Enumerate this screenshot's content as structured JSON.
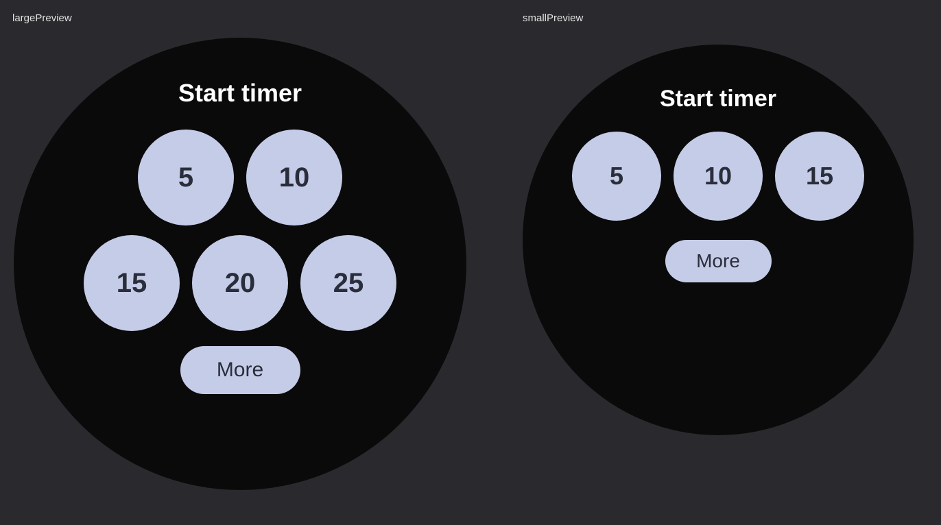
{
  "large_preview": {
    "label": "largePreview",
    "title": "Start timer",
    "row1": [
      "5",
      "10"
    ],
    "row2": [
      "15",
      "20",
      "25"
    ],
    "more": "More"
  },
  "small_preview": {
    "label": "smallPreview",
    "title": "Start timer",
    "row1": [
      "5",
      "10",
      "15"
    ],
    "more": "More"
  }
}
